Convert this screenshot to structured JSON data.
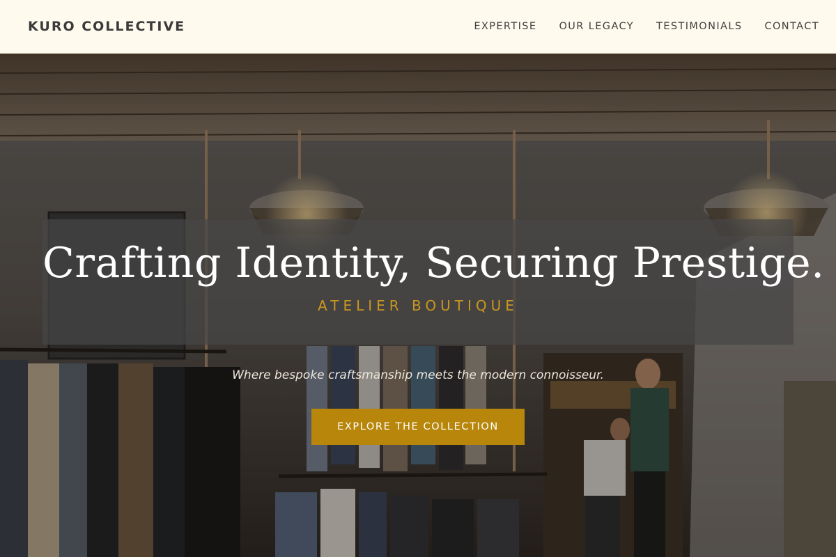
{
  "header": {
    "brand": "KURO COLLECTIVE",
    "nav": [
      {
        "label": "EXPERTISE"
      },
      {
        "label": "OUR LEGACY"
      },
      {
        "label": "TESTIMONIALS"
      },
      {
        "label": "CONTACT"
      }
    ]
  },
  "hero": {
    "title": "Crafting Identity, Securing Prestige.",
    "subtitle": "ATELIER BOUTIQUE",
    "tagline": "Where bespoke craftsmanship meets the modern connoisseur.",
    "cta_label": "EXPLORE THE COLLECTION",
    "image_description_icon": "clothing-store-interior-photo"
  },
  "colors": {
    "header_bg": "#fffaee",
    "accent_gold": "#b8860b",
    "subtitle_gold": "#c9961f",
    "panel_bg": "#464646"
  }
}
